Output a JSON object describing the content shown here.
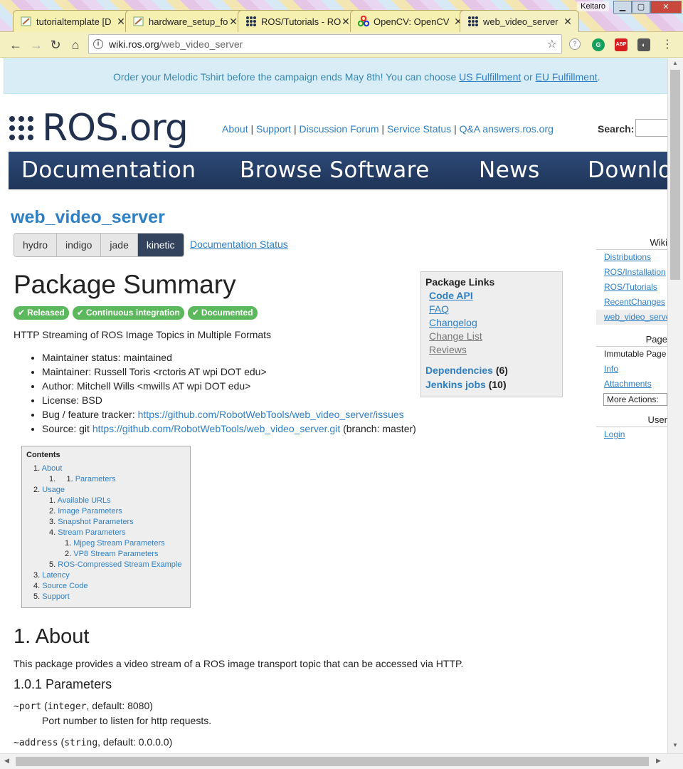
{
  "browser": {
    "tabs": [
      {
        "title": "tutorialtemplate [D",
        "icon": "edit-page-icon"
      },
      {
        "title": "hardware_setup_fo",
        "icon": "edit-page-icon"
      },
      {
        "title": "ROS/Tutorials - RO",
        "icon": "ros-grid-icon"
      },
      {
        "title": "OpenCV: OpenCV",
        "icon": "opencv-icon"
      },
      {
        "title": "web_video_server",
        "icon": "ros-grid-icon"
      }
    ],
    "user": "Keitaro",
    "url_host": "wiki.ros.org",
    "url_path": "/web_video_server"
  },
  "banner": {
    "text": "Order your Melodic Tshirt before the campaign ends May 8th! You can choose ",
    "link1": "US Fulfillment",
    "mid": " or ",
    "link2": "EU Fulfillment",
    "end": "."
  },
  "header": {
    "logo": "ROS.org",
    "links": [
      "About",
      "Support",
      "Discussion Forum",
      "Service Status",
      "Q&A answers.ros.org"
    ],
    "search_label": "Search:"
  },
  "nav": [
    "Documentation",
    "Browse Software",
    "News",
    "Download"
  ],
  "package": {
    "name": "web_video_server",
    "distros": [
      "hydro",
      "indigo",
      "jade",
      "kinetic"
    ],
    "selected_distro": "kinetic",
    "doc_status": "Documentation Status",
    "summary_title": "Package Summary",
    "badges": [
      "Released",
      "Continuous integration",
      "Documented"
    ],
    "description": "HTTP Streaming of ROS Image Topics in Multiple Formats",
    "meta": {
      "maintainer_status": "Maintainer status: maintained",
      "maintainer": "Maintainer: Russell Toris <rctoris AT wpi DOT edu>",
      "author": "Author: Mitchell Wills <mwills AT wpi DOT edu>",
      "license": "License: BSD",
      "bug_label": "Bug / feature tracker: ",
      "bug_url": "https://github.com/RobotWebTools/web_video_server/issues",
      "source_label": "Source: git ",
      "source_url": "https://github.com/RobotWebTools/web_video_server.git",
      "source_branch": " (branch: master)"
    }
  },
  "package_links": {
    "title": "Package Links",
    "links": [
      "Code API",
      "FAQ",
      "Changelog",
      "Change List",
      "Reviews"
    ],
    "deps_label": "Dependencies",
    "deps_count": "(6)",
    "jenkins_label": "Jenkins jobs",
    "jenkins_count": "(10)"
  },
  "toc": {
    "title": "Contents",
    "items": [
      {
        "num": "1.",
        "label": "About"
      },
      {
        "num": "1.",
        "label": "Parameters"
      },
      {
        "num": "2.",
        "label": "Usage"
      },
      {
        "num": "1.",
        "label": "Available URLs"
      },
      {
        "num": "2.",
        "label": "Image Parameters"
      },
      {
        "num": "3.",
        "label": "Snapshot Parameters"
      },
      {
        "num": "4.",
        "label": "Stream Parameters"
      },
      {
        "num": "1.",
        "label": "Mjpeg Stream Parameters"
      },
      {
        "num": "2.",
        "label": "VP8 Stream Parameters"
      },
      {
        "num": "5.",
        "label": "ROS-Compressed Stream Example"
      },
      {
        "num": "3.",
        "label": "Latency"
      },
      {
        "num": "4.",
        "label": "Source Code"
      },
      {
        "num": "5.",
        "label": "Support"
      }
    ]
  },
  "about": {
    "heading": "1. About",
    "text": "This package provides a video stream of a ROS image transport topic that can be accessed via HTTP.",
    "params_heading": "1.0.1 Parameters",
    "port_name": "~port",
    "port_type": "integer",
    "port_default": ", default: 8080)",
    "port_desc": "Port number to listen for http requests.",
    "address_name": "~address",
    "address_type": "string",
    "address_default": ", default: 0.0.0.0)"
  },
  "sidebar": {
    "wiki_hd": "Wiki",
    "wiki_items": [
      "Distributions",
      "ROS/Installation",
      "ROS/Tutorials",
      "RecentChanges",
      "web_video_server"
    ],
    "page_hd": "Page",
    "page_items": [
      "Immutable Page",
      "Info",
      "Attachments"
    ],
    "more_actions": "More Actions:",
    "user_hd": "User",
    "login": "Login"
  }
}
